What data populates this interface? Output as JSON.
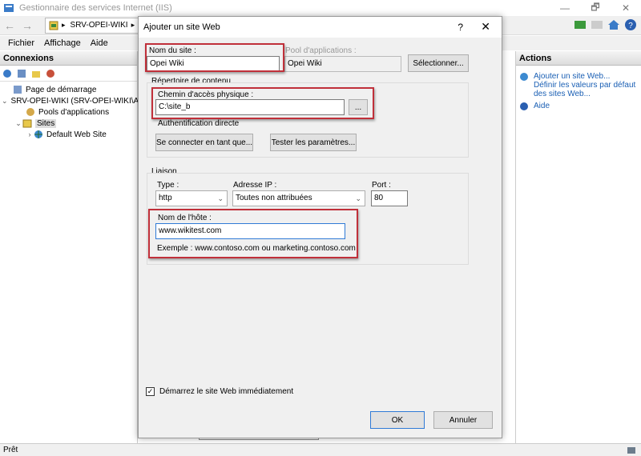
{
  "window": {
    "title": "Gestionnaire des services Internet (IIS)",
    "minimize": "—",
    "maximize": "🗗",
    "close": "✕"
  },
  "address": {
    "back": "←",
    "forward": "→",
    "crumb": "SRV-OPEI-WIKI",
    "separator": "▸"
  },
  "menu": [
    "Fichier",
    "Affichage",
    "Aide"
  ],
  "connections": {
    "header": "Connexions",
    "tree": [
      {
        "label": "Page de démarrage",
        "expander": ""
      },
      {
        "label": "SRV-OPEI-WIKI (SRV-OPEI-WIKI\\A",
        "expander": "⌄"
      },
      {
        "label": "Pools d'applications",
        "expander": ""
      },
      {
        "label": "Sites",
        "expander": "⌄"
      },
      {
        "label": "Default Web Site",
        "expander": "›"
      }
    ]
  },
  "actions": {
    "header": "Actions",
    "add_site": "Ajouter un site Web...",
    "defaults": "Définir les valeurs par défaut des sites Web...",
    "help": "Aide"
  },
  "status": "Prêt",
  "dialog": {
    "title": "Ajouter un site Web",
    "help_btn": "?",
    "close_btn": "✕",
    "site_name_label": "Nom du site :",
    "site_name_value": "Opei Wiki",
    "app_pool_label": "Pool d'applications :",
    "app_pool_value": "Opei Wiki",
    "select_button": "Sélectionner...",
    "content_dir_label": "Répertoire de contenu",
    "physical_path_label": "Chemin d'accès physique :",
    "physical_path_value": "C:\\site_b",
    "browse_button": "...",
    "pass_through_label": "Authentification directe",
    "connect_as_button": "Se connecter en tant que...",
    "test_settings_button": "Tester les paramètres...",
    "binding_label": "Liaison",
    "type_label": "Type :",
    "type_value": "http",
    "ip_label": "Adresse IP :",
    "ip_value": "Toutes non attribuées",
    "port_label": "Port :",
    "port_value": "80",
    "hostname_label": "Nom de l'hôte :",
    "hostname_value": "www.wikitest.com",
    "example_text": "Exemple : www.contoso.com ou marketing.contoso.com",
    "start_checkbox_label": "Démarrez le site Web immédiatement",
    "start_checked": true,
    "ok_button": "OK",
    "cancel_button": "Annuler"
  },
  "colors": {
    "highlight_box": "#c0303a",
    "link": "#1a5fb4",
    "focus": "#2f7ad6"
  }
}
